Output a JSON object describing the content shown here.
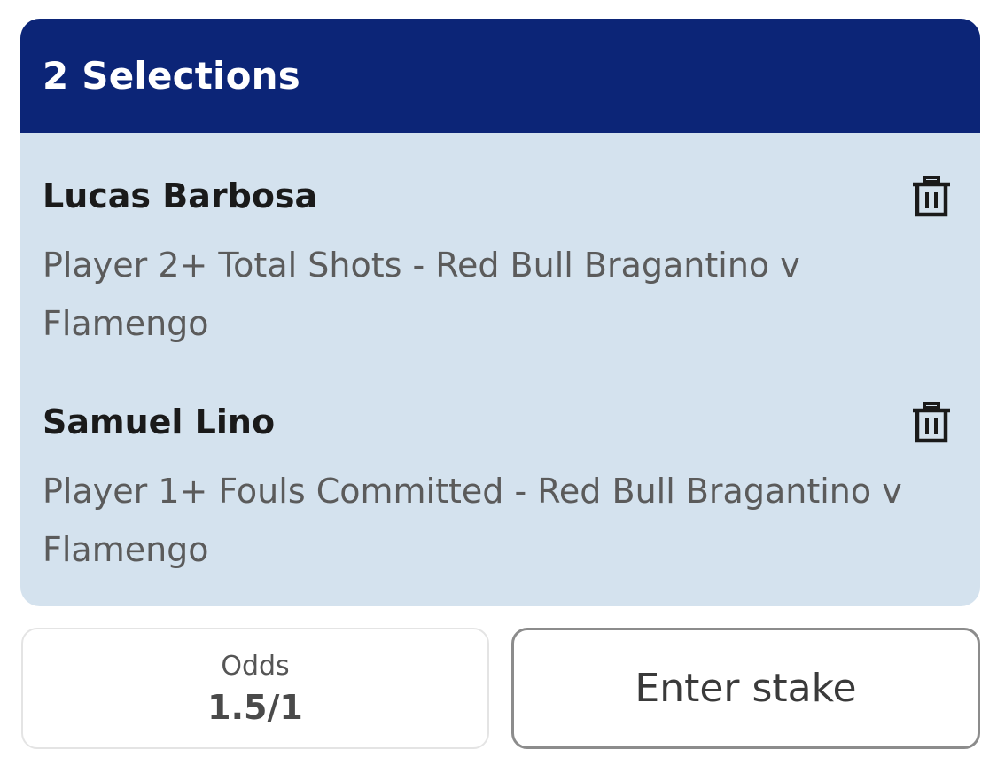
{
  "betslip": {
    "title": "2 Selections",
    "header_color": "#0c2577",
    "selections": [
      {
        "name": "Lucas Barbosa",
        "market": "Player 2+ Total Shots - Red Bull Bragantino v Flamengo",
        "delete_icon": "trash-icon"
      },
      {
        "name": "Samuel Lino",
        "market": "Player 1+ Fouls Committed - Red Bull Bragantino v Flamengo",
        "delete_icon": "trash-icon"
      }
    ]
  },
  "odds": {
    "label": "Odds",
    "value": "1.5/1"
  },
  "stake": {
    "placeholder": "Enter stake",
    "value": ""
  }
}
